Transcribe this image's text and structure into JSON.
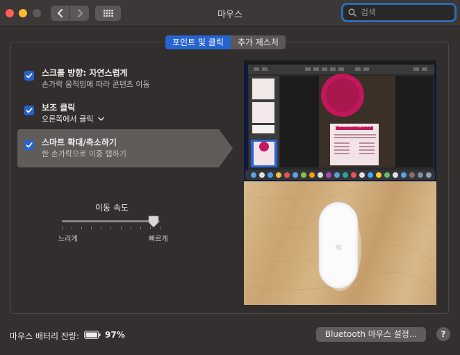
{
  "window": {
    "title": "마우스"
  },
  "toolbar": {
    "back_icon": "chevron-left-icon",
    "forward_icon": "chevron-right-icon",
    "grid_icon": "grid-icon"
  },
  "search": {
    "placeholder": "검색",
    "icon": "search-icon"
  },
  "tabs": [
    {
      "label": "포인트 및 클릭",
      "active": true
    },
    {
      "label": "추가 제스처",
      "active": false
    }
  ],
  "options": [
    {
      "title": "스크롤 방향: 자연스럽게",
      "subtitle": "손가락 움직임에 따라 콘텐츠 이동",
      "checked": true
    },
    {
      "title": "보조 클릭",
      "subtitle": "오른쪽에서 클릭",
      "checked": true,
      "has_dropdown": true
    },
    {
      "title": "스마트 확대/축소하기",
      "subtitle": "한 손가락으로 이중 탭하기",
      "checked": true,
      "selected": true
    }
  ],
  "tracking_speed": {
    "label": "이동 속도",
    "min_label": "느리게",
    "max_label": "빠르게",
    "value_fraction": 0.93
  },
  "preview": {
    "document_title": "Hibiscus Popsicles"
  },
  "battery": {
    "label": "마우스 배터리 잔량:",
    "percent": "97%"
  },
  "bluetooth_button": {
    "label": "Bluetooth 마우스 설정..."
  },
  "help_button": {
    "label": "?"
  },
  "colors": {
    "accent": "#2864d1",
    "close": "#ff5f57",
    "minimize": "#febc2e"
  }
}
